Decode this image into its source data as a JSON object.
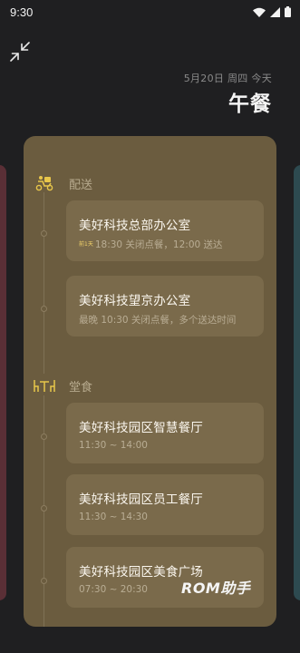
{
  "status_bar": {
    "time": "9:30"
  },
  "header": {
    "date": "5月20日 周四 今天",
    "meal": "午餐"
  },
  "sections": [
    {
      "label": "配送",
      "items": [
        {
          "name": "美好科技总部办公室",
          "badge": "前1天",
          "detail": "18:30 关闭点餐，12:00 送达"
        },
        {
          "name": "美好科技望京办公室",
          "detail": "最晚 10:30 关闭点餐，多个送达时间"
        }
      ]
    },
    {
      "label": "堂食",
      "items": [
        {
          "name": "美好科技园区智慧餐厅",
          "detail": "11:30 ~ 14:00"
        },
        {
          "name": "美好科技园区员工餐厅",
          "detail": "11:30 ~ 14:30"
        },
        {
          "name": "美好科技园区美食广场",
          "detail": "07:30 ~ 20:30"
        }
      ]
    }
  ],
  "watermark": "ROM助手",
  "colors": {
    "background": "#1f1f21",
    "card": "#6b5c3f",
    "item": "#7a6a4b",
    "accent": "#e8c64a"
  }
}
